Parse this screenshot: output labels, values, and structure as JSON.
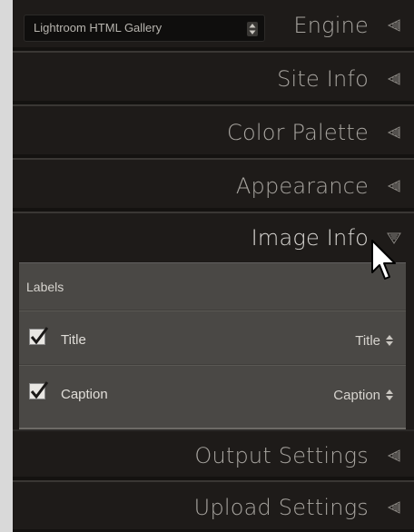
{
  "engine": {
    "selected": "Lightroom HTML Gallery",
    "title": "Engine"
  },
  "sections": {
    "site_info": "Site Info",
    "color_palette": "Color Palette",
    "appearance": "Appearance",
    "image_info": "Image Info",
    "output_settings": "Output Settings",
    "upload_settings": "Upload Settings"
  },
  "image_info": {
    "labels_heading": "Labels",
    "rows": [
      {
        "label": "Title",
        "checked": true,
        "value": "Title"
      },
      {
        "label": "Caption",
        "checked": true,
        "value": "Caption"
      }
    ]
  },
  "colors": {
    "panel_bg": "#1e1b19",
    "expanded_bg": "#4a4845",
    "title_text": "#a8a5a0"
  },
  "icons": {
    "collapsed": "triangle-left-icon",
    "expanded": "triangle-down-icon",
    "select": "updown-arrows-icon",
    "cursor": "mouse-pointer-icon"
  }
}
